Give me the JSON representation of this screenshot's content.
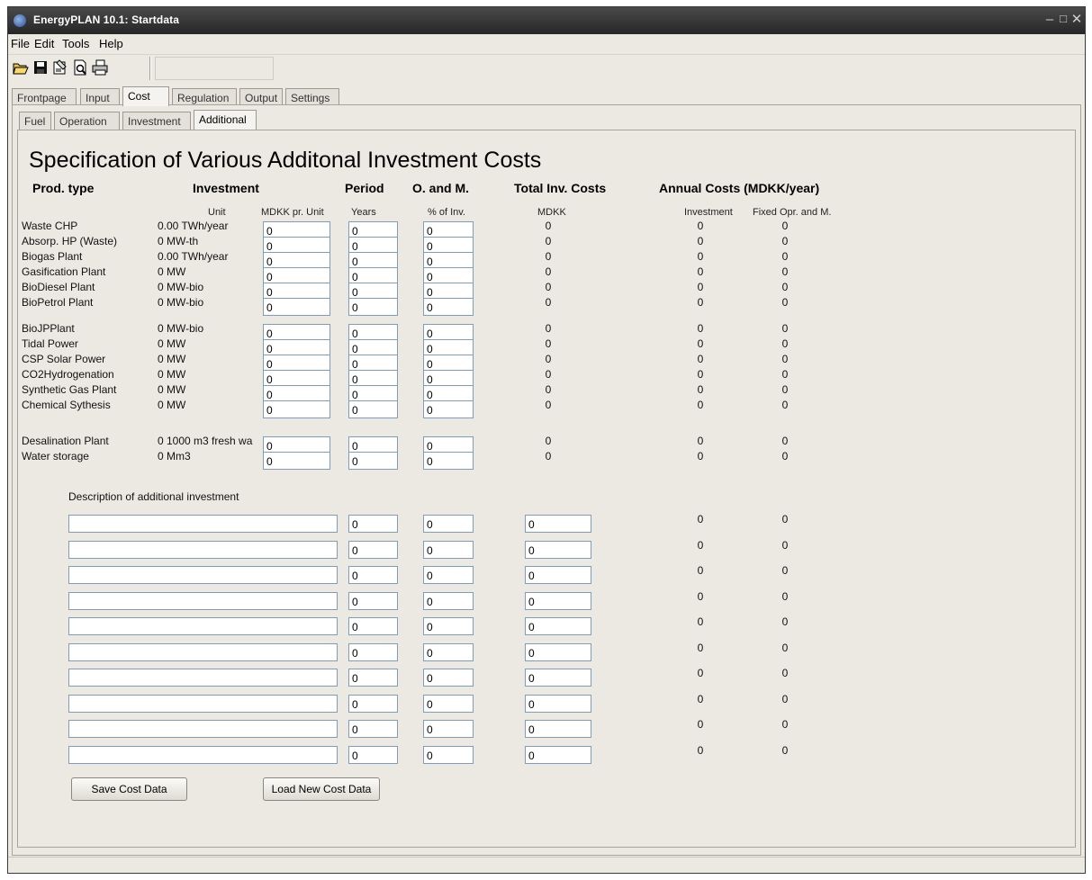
{
  "window": {
    "title": "EnergyPLAN 10.1: Startdata"
  },
  "menu": [
    "File",
    "Edit",
    "Tools",
    "Help"
  ],
  "toolbar_icons": [
    "open-icon",
    "save-icon",
    "properties-icon",
    "print-preview-icon",
    "print-icon"
  ],
  "tabs": [
    "Frontpage",
    "Input",
    "Cost",
    "Regulation",
    "Output",
    "Settings"
  ],
  "active_tab": "Cost",
  "subtabs": [
    "Fuel",
    "Operation",
    "Investment",
    "Additional"
  ],
  "active_subtab": "Additional",
  "heading": "Specification of Various Additonal Investment Costs",
  "columns": {
    "prod_type": "Prod. type",
    "investment": "Investment",
    "period": "Period",
    "om": "O. and M.",
    "total": "Total Inv. Costs",
    "annual": "Annual Costs (MDKK/year)"
  },
  "subheaders": {
    "unit": "Unit",
    "mdkk_pr_unit": "MDKK pr. Unit",
    "years": "Years",
    "pct_inv": "% of Inv.",
    "mdkk": "MDKK",
    "annual_investment": "Investment",
    "annual_fixed": "Fixed Opr. and M."
  },
  "rows": [
    {
      "name": "Waste CHP",
      "amount": "0.00 TWh/year",
      "inv": "0",
      "period": "0",
      "om": "0",
      "total": "0",
      "annual_inv": "0",
      "annual_fixed": "0"
    },
    {
      "name": "Absorp. HP (Waste)",
      "amount": "0 MW-th",
      "inv": "0",
      "period": "0",
      "om": "0",
      "total": "0",
      "annual_inv": "0",
      "annual_fixed": "0"
    },
    {
      "name": "Biogas Plant",
      "amount": "0.00 TWh/year",
      "inv": "0",
      "period": "0",
      "om": "0",
      "total": "0",
      "annual_inv": "0",
      "annual_fixed": "0"
    },
    {
      "name": "Gasification Plant",
      "amount": "0 MW",
      "inv": "0",
      "period": "0",
      "om": "0",
      "total": "0",
      "annual_inv": "0",
      "annual_fixed": "0"
    },
    {
      "name": "BioDiesel Plant",
      "amount": "0 MW-bio",
      "inv": "0",
      "period": "0",
      "om": "0",
      "total": "0",
      "annual_inv": "0",
      "annual_fixed": "0"
    },
    {
      "name": "BioPetrol Plant",
      "amount": "0 MW-bio",
      "inv": "0",
      "period": "0",
      "om": "0",
      "total": "0",
      "annual_inv": "0",
      "annual_fixed": "0"
    },
    {
      "name": "BioJPPlant",
      "amount": "0 MW-bio",
      "inv": "0",
      "period": "0",
      "om": "0",
      "total": "0",
      "annual_inv": "0",
      "annual_fixed": "0"
    },
    {
      "name": "Tidal Power",
      "amount": "0 MW",
      "inv": "0",
      "period": "0",
      "om": "0",
      "total": "0",
      "annual_inv": "0",
      "annual_fixed": "0"
    },
    {
      "name": "CSP Solar Power",
      "amount": "0 MW",
      "inv": "0",
      "period": "0",
      "om": "0",
      "total": "0",
      "annual_inv": "0",
      "annual_fixed": "0"
    },
    {
      "name": "CO2Hydrogenation",
      "amount": "0 MW",
      "inv": "0",
      "period": "0",
      "om": "0",
      "total": "0",
      "annual_inv": "0",
      "annual_fixed": "0"
    },
    {
      "name": "Synthetic Gas Plant",
      "amount": "0 MW",
      "inv": "0",
      "period": "0",
      "om": "0",
      "total": "0",
      "annual_inv": "0",
      "annual_fixed": "0"
    },
    {
      "name": "Chemical Sythesis",
      "amount": "0 MW",
      "inv": "0",
      "period": "0",
      "om": "0",
      "total": "0",
      "annual_inv": "0",
      "annual_fixed": "0"
    },
    {
      "name": "Desalination Plant",
      "amount": "0 1000 m3 fresh wa",
      "inv": "0",
      "period": "0",
      "om": "0",
      "total": "0",
      "annual_inv": "0",
      "annual_fixed": "0"
    },
    {
      "name": "Water storage",
      "amount": "0 Mm3",
      "inv": "0",
      "period": "0",
      "om": "0",
      "total": "0",
      "annual_inv": "0",
      "annual_fixed": "0"
    }
  ],
  "additional": {
    "label": "Description of additional investment",
    "rows": [
      {
        "description": "",
        "period": "0",
        "om": "0",
        "total": "0",
        "annual_inv": "0",
        "annual_fixed": "0"
      },
      {
        "description": "",
        "period": "0",
        "om": "0",
        "total": "0",
        "annual_inv": "0",
        "annual_fixed": "0"
      },
      {
        "description": "",
        "period": "0",
        "om": "0",
        "total": "0",
        "annual_inv": "0",
        "annual_fixed": "0"
      },
      {
        "description": "",
        "period": "0",
        "om": "0",
        "total": "0",
        "annual_inv": "0",
        "annual_fixed": "0"
      },
      {
        "description": "",
        "period": "0",
        "om": "0",
        "total": "0",
        "annual_inv": "0",
        "annual_fixed": "0"
      },
      {
        "description": "",
        "period": "0",
        "om": "0",
        "total": "0",
        "annual_inv": "0",
        "annual_fixed": "0"
      },
      {
        "description": "",
        "period": "0",
        "om": "0",
        "total": "0",
        "annual_inv": "0",
        "annual_fixed": "0"
      },
      {
        "description": "",
        "period": "0",
        "om": "0",
        "total": "0",
        "annual_inv": "0",
        "annual_fixed": "0"
      },
      {
        "description": "",
        "period": "0",
        "om": "0",
        "total": "0",
        "annual_inv": "0",
        "annual_fixed": "0"
      },
      {
        "description": "",
        "period": "0",
        "om": "0",
        "total": "0",
        "annual_inv": "0",
        "annual_fixed": "0"
      }
    ]
  },
  "buttons": {
    "save": "Save Cost Data",
    "load": "Load New Cost Data"
  }
}
